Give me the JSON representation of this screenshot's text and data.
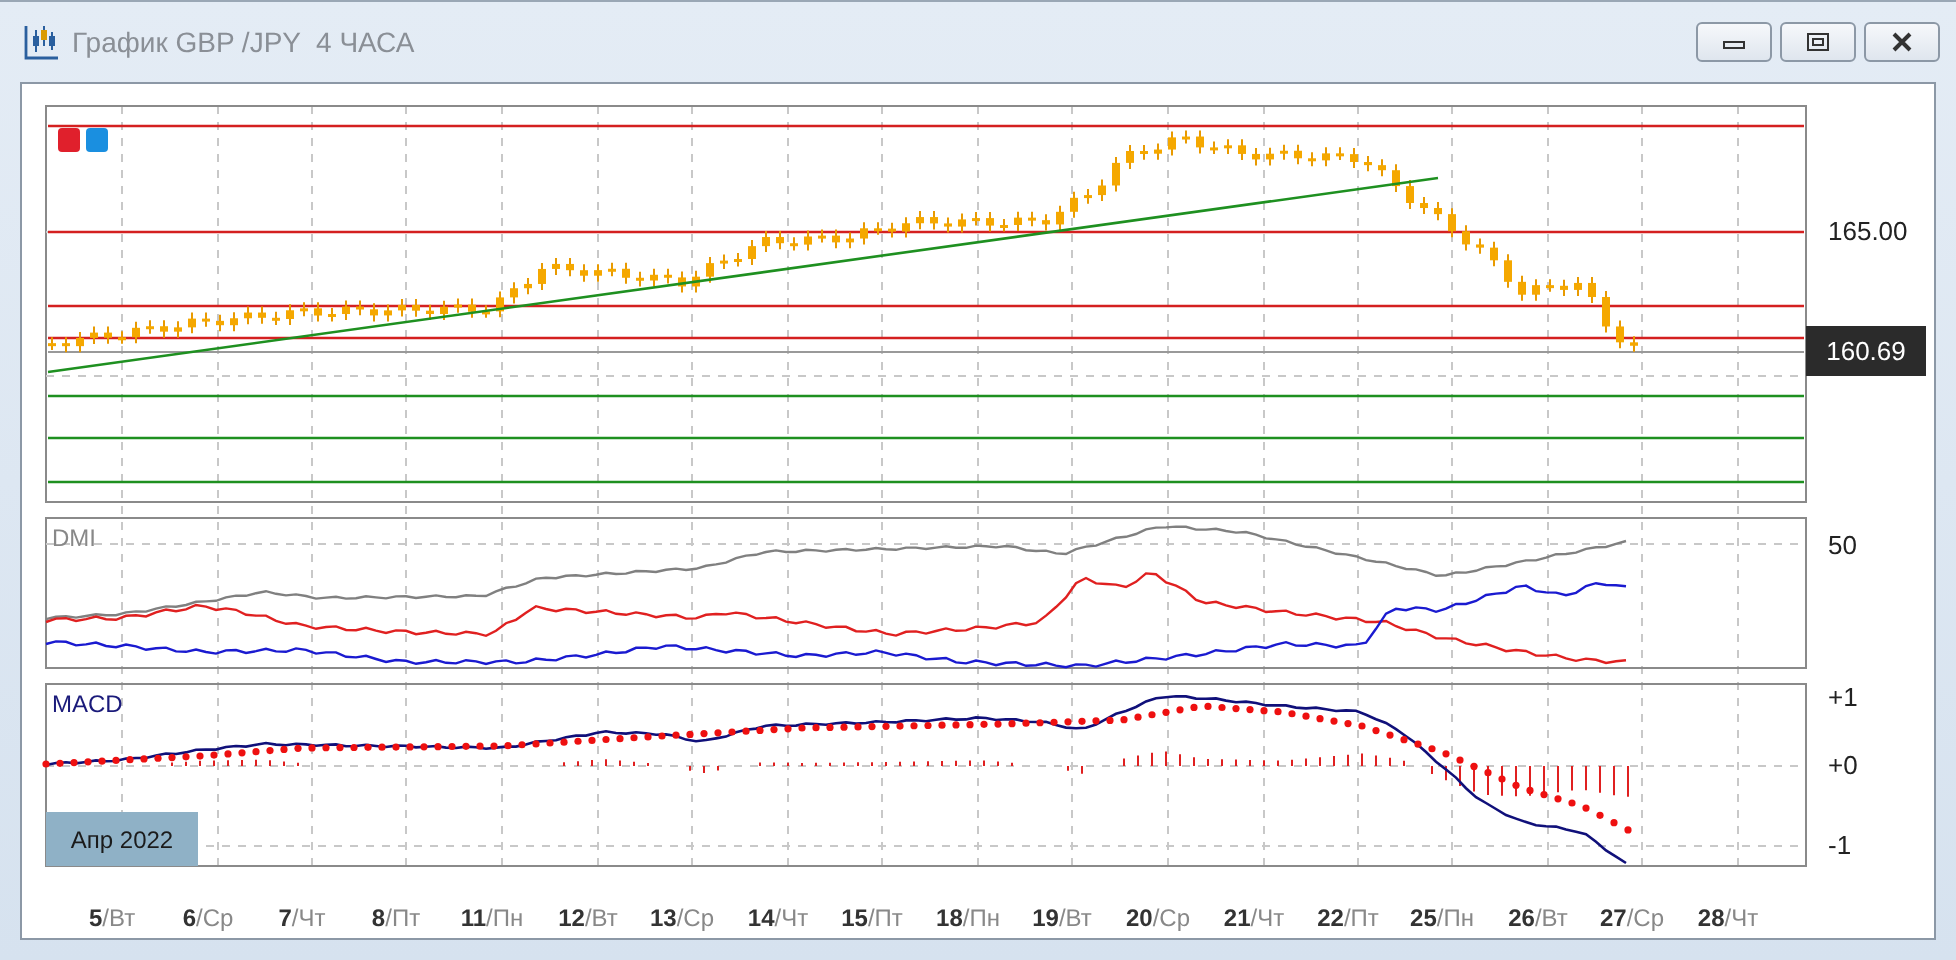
{
  "window": {
    "title": "График GBP /JPY  4 ЧАСА"
  },
  "price_panel": {
    "axis_labels": [
      "165.00"
    ],
    "current_price": "160.69"
  },
  "dmi_panel": {
    "title": "DMI",
    "axis_labels": [
      "50"
    ]
  },
  "macd_panel": {
    "title": "MACD",
    "axis_labels": [
      "+1",
      "+0",
      "-1"
    ],
    "period_badge": "Апр 2022"
  },
  "time_axis": [
    {
      "day": "5",
      "weekday": "/Вт"
    },
    {
      "day": "6",
      "weekday": "/Ср"
    },
    {
      "day": "7",
      "weekday": "/Чт"
    },
    {
      "day": "8",
      "weekday": "/Пт"
    },
    {
      "day": "11",
      "weekday": "/Пн"
    },
    {
      "day": "12",
      "weekday": "/Вт"
    },
    {
      "day": "13",
      "weekday": "/Ср"
    },
    {
      "day": "14",
      "weekday": "/Чт"
    },
    {
      "day": "15",
      "weekday": "/Пт"
    },
    {
      "day": "18",
      "weekday": "/Пн"
    },
    {
      "day": "19",
      "weekday": "/Вт"
    },
    {
      "day": "20",
      "weekday": "/Ср"
    },
    {
      "day": "21",
      "weekday": "/Чт"
    },
    {
      "day": "22",
      "weekday": "/Пт"
    },
    {
      "day": "25",
      "weekday": "/Пн"
    },
    {
      "day": "26",
      "weekday": "/Вт"
    },
    {
      "day": "27",
      "weekday": "/Ср"
    },
    {
      "day": "28",
      "weekday": "/Чт"
    }
  ]
}
